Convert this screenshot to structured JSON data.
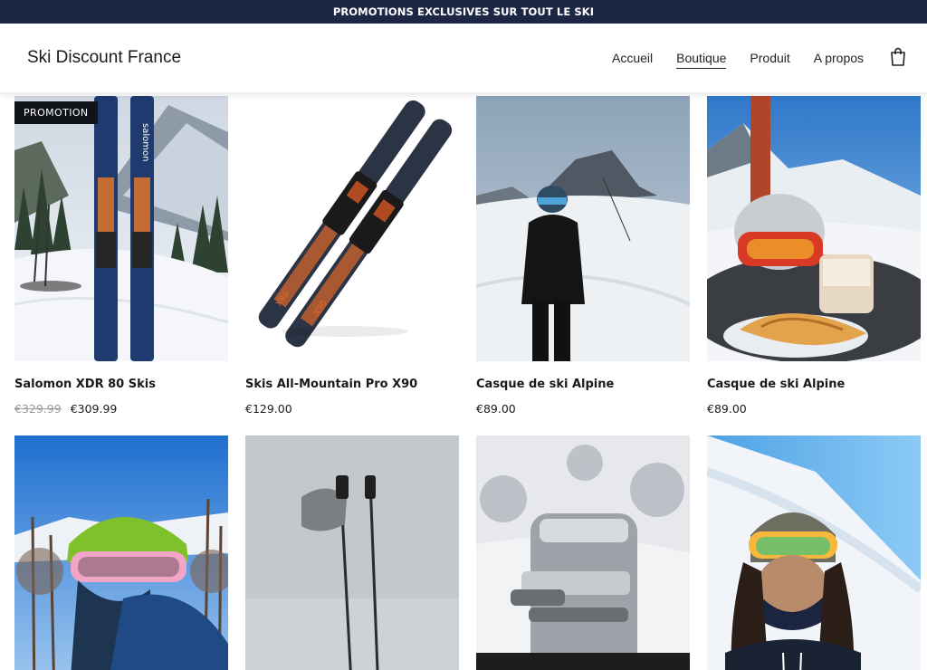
{
  "promo_banner": {
    "text": "PROMOTIONS EXCLUSIVES SUR TOUT LE SKI"
  },
  "header": {
    "brand": "Ski Discount France",
    "nav": [
      {
        "label": "Accueil",
        "active": false
      },
      {
        "label": "Boutique",
        "active": true
      },
      {
        "label": "Produit",
        "active": false
      },
      {
        "label": "A propos",
        "active": false
      }
    ],
    "cart_icon": "shopping-bag-icon"
  },
  "products": [
    {
      "badge": "PROMOTION",
      "title": "Salomon XDR 80 Skis",
      "old_price": "€329.99",
      "price": "€309.99",
      "image": "skis-in-snow"
    },
    {
      "title": "Skis All-Mountain Pro X90",
      "price": "€129.00",
      "image": "skis-product"
    },
    {
      "title": "Casque de ski Alpine",
      "price": "€89.00",
      "image": "skier-mountain"
    },
    {
      "title": "Casque de ski Alpine",
      "price": "€89.00",
      "image": "helmet-on-table"
    },
    {
      "image": "green-helmet-skier"
    },
    {
      "image": "ski-poles-fog"
    },
    {
      "image": "ski-boot-snow"
    },
    {
      "image": "selfie-skier"
    }
  ]
}
